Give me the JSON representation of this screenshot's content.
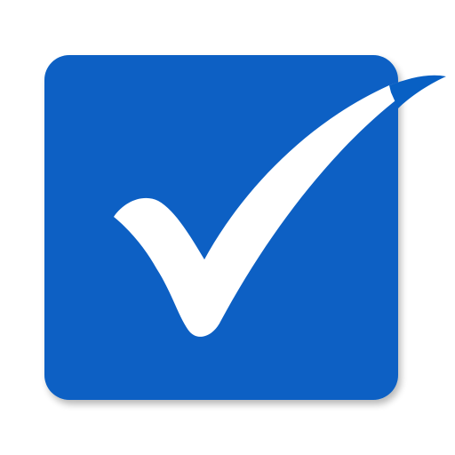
{
  "icon": {
    "name": "checkbox-checked-icon",
    "state": "checked",
    "colors": {
      "background": "#ffffff",
      "box_fill": "#0860c4",
      "box_shadow": "#cfcfcf",
      "check_mark": "#ffffff",
      "check_tail": "#0860c4"
    }
  }
}
